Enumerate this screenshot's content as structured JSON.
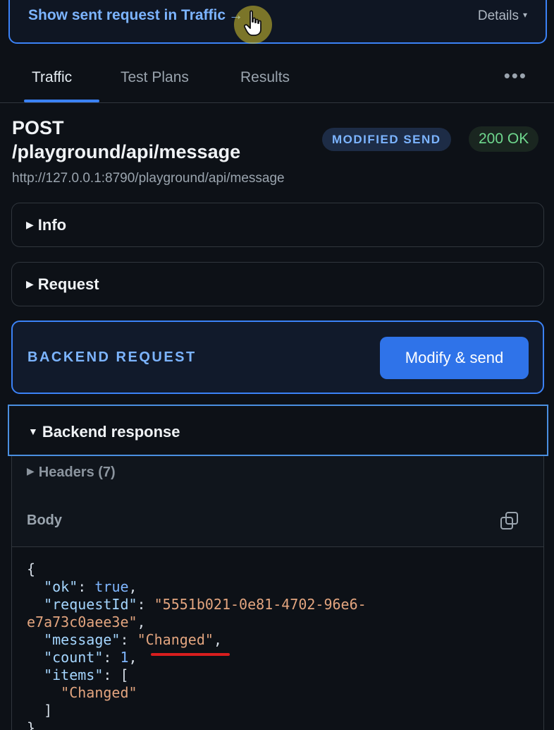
{
  "banner": {
    "link_text": "Show sent request in Traffic",
    "link_arrow": "→",
    "details_label": "Details",
    "details_caret": "▾"
  },
  "tabs": [
    {
      "label": "Traffic",
      "active": true
    },
    {
      "label": "Test Plans",
      "active": false
    },
    {
      "label": "Results",
      "active": false
    }
  ],
  "more_menu": "•••",
  "request": {
    "method": "POST",
    "path": "/playground/api/message",
    "badge_mode": "MODIFIED SEND",
    "badge_status": "200 OK",
    "url": "http://127.0.0.1:8790/playground/api/message"
  },
  "sections": {
    "info": {
      "label": "Info",
      "toggle": "▶"
    },
    "request": {
      "label": "Request",
      "toggle": "▶"
    }
  },
  "backend_request": {
    "label": "BACKEND REQUEST",
    "button_label": "Modify & send"
  },
  "backend_response": {
    "label": "Backend response",
    "toggle": "▼",
    "headers_label": "Headers (7)",
    "headers_toggle": "▶",
    "body_label": "Body"
  },
  "body_json": {
    "ok": "true",
    "requestId_line1": "\"5551b021-0e81-4702-96e6-",
    "requestId_line2": "e7a73c0aee3e\"",
    "message": "\"Changed\"",
    "count": "1",
    "items_0": "\"Changed\""
  },
  "colors": {
    "accent": "#3b82f6",
    "link": "#7cb4ff",
    "success": "#6fd88e",
    "string": "#e3a57f",
    "highlight_underline": "#d81e1e"
  }
}
